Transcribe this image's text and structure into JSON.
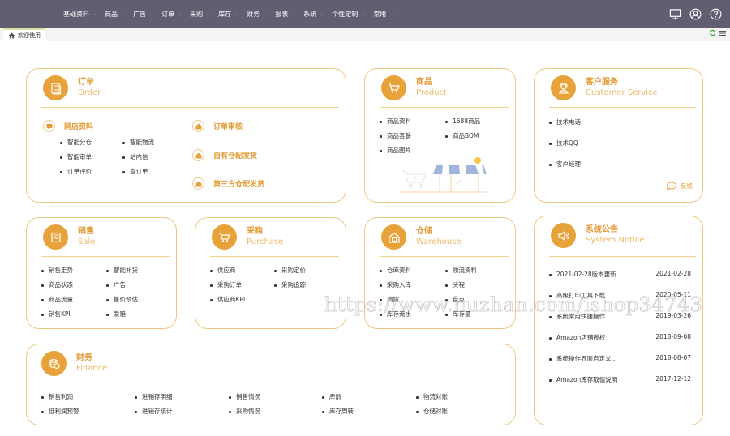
{
  "nav": {
    "items": [
      "基础资料",
      "商品",
      "广告",
      "订单",
      "采购",
      "库存",
      "财务",
      "报表",
      "系统",
      "个性定制",
      "常用"
    ]
  },
  "header_icons": [
    "monitor-icon",
    "user-icon",
    "help-icon"
  ],
  "tabs": {
    "active": "欢迎使用"
  },
  "colors": {
    "accent": "#e8a23a",
    "title": "#e39a34",
    "border": "#edc880",
    "topbar": "#625e72"
  },
  "order": {
    "title_cn": "订单",
    "title_en": "Order",
    "shop": {
      "label": "网店资料",
      "col1": [
        "智能分仓",
        "智能审单",
        "订单评价"
      ],
      "col2": [
        "智能物流",
        "站内信",
        "查订单"
      ]
    },
    "actions": [
      "订单审核",
      "自有仓配发货",
      "第三方仓配发货"
    ]
  },
  "product": {
    "title_cn": "商品",
    "title_en": "Product",
    "col1": [
      "商品资料",
      "商品套餐",
      "商品图片"
    ],
    "col2": [
      "1688商品",
      "商品BOM"
    ]
  },
  "service": {
    "title_cn": "客户服务",
    "title_en": "Customer Service",
    "items": [
      "技术电话",
      "技术QQ",
      "客户经理"
    ],
    "feedback": "反馈"
  },
  "sale": {
    "title_cn": "销售",
    "title_en": "Sale",
    "col1": [
      "销售走势",
      "商品状态",
      "商品流量",
      "销售KPI"
    ],
    "col2": [
      "智能补货",
      "广告",
      "售价预估",
      "爱赔"
    ]
  },
  "purchase": {
    "title_cn": "采购",
    "title_en": "Purchase",
    "col1": [
      "供应商",
      "采购订单",
      "供应商KPI"
    ],
    "col2": [
      "采购定价",
      "采购追踪"
    ]
  },
  "warehouse": {
    "title_cn": "仓储",
    "title_en": "Warehouse",
    "col1": [
      "仓库资料",
      "采购入库",
      "调拨",
      "库存流水"
    ],
    "col2": [
      "物流资料",
      "头程",
      "盘点",
      "库存量"
    ]
  },
  "notice": {
    "title_cn": "系统公告",
    "title_en": "System Notice",
    "items": [
      {
        "title": "2021-02-28版本更新...",
        "date": "2021-02-28"
      },
      {
        "title": "高级打印工具下载",
        "date": "2020-05-11"
      },
      {
        "title": "系统常用快捷操作",
        "date": "2019-03-26"
      },
      {
        "title": "Amazon店铺授权",
        "date": "2018-09-08"
      },
      {
        "title": "系统操作界面自定义...",
        "date": "2018-08-07"
      },
      {
        "title": "Amazon库存取值说明",
        "date": "2017-12-12"
      }
    ]
  },
  "finance": {
    "title_cn": "财务",
    "title_en": "Finance",
    "cols": [
      [
        "销售利润",
        "低利润预警"
      ],
      [
        "进销存明细",
        "进销存统计"
      ],
      [
        "销售情况",
        "采购情况"
      ],
      [
        "库龄",
        "库存周转"
      ],
      [
        "物流对账",
        "仓储对账"
      ]
    ]
  },
  "watermark": "https://www.huzhan.com/ishop34743"
}
